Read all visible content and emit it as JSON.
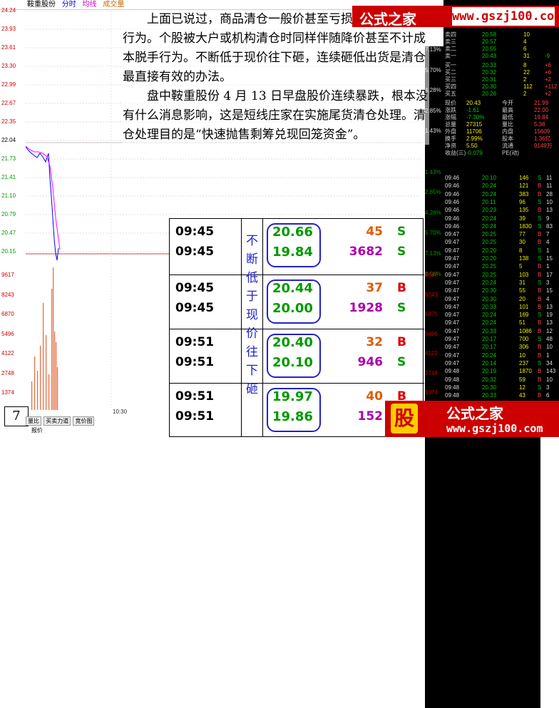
{
  "chart_header": {
    "stock_name": "鞍重股份",
    "tab_timeshare": "分时",
    "tab_avg": "均线",
    "tab_volume": "成交量"
  },
  "price_axis_left": [
    "24.24",
    "23.93",
    "23.61",
    "23.30",
    "22.99",
    "22.67",
    "22.35",
    "22.04",
    "21.73",
    "21.41",
    "21.10",
    "20.79",
    "20.47",
    "20.15"
  ],
  "price_axis_right": [
    "7.13%",
    "5.70%",
    "4.28%",
    "2.85%",
    "1.43%",
    "0.00%",
    "1.43%",
    "2.85%",
    "4.28%",
    "5.70%",
    "7.13%",
    "8.56%"
  ],
  "volume_axis_left": [
    "9617",
    "8243",
    "6870",
    "5496",
    "4122",
    "2748",
    "1374"
  ],
  "volume_axis_right": [
    "9617",
    "8243",
    "6870",
    "5496",
    "4122",
    "2748",
    "1374"
  ],
  "x_tick": "10:30",
  "bottom_tabs": [
    "量比",
    "买卖力道",
    "竞价图"
  ],
  "bottom_tab_extra": "报价",
  "page_number": "7",
  "body_text": {
    "p1": "上面已说过，商品清仓一般价甚至亏损不计成本抛售行为。个股被大户或机构清仓时同样伴随降价甚至不计成本脱手行为。不断低于现价往下砸，连续砸低出货是清仓最直接有效的办法。",
    "p2": "盘中鞍重股份 4 月 13 日早盘股价连续暴跌，根本没有什么消息影响，这是短线庄家在实施尾货清仓处理。清仓处理目的是“快速抛售剩筹兑现回笼资金”。"
  },
  "table": {
    "side_caption": [
      "不",
      "断",
      "低",
      "于",
      "现",
      "价",
      "往",
      "下",
      "砸"
    ],
    "groups": [
      {
        "rows": [
          {
            "time": "09:45",
            "price": "20.66",
            "vol": "45",
            "side": "S",
            "vol_color": "#e05a00",
            "side_color": "#090"
          },
          {
            "time": "09:45",
            "price": "19.84",
            "vol": "3682",
            "side": "S",
            "vol_color": "#a0a",
            "side_color": "#090"
          }
        ]
      },
      {
        "rows": [
          {
            "time": "09:45",
            "price": "20.44",
            "vol": "37",
            "side": "B",
            "vol_color": "#e05a00",
            "side_color": "#d00"
          },
          {
            "time": "09:45",
            "price": "20.00",
            "vol": "1928",
            "side": "S",
            "vol_color": "#a0a",
            "side_color": "#090"
          }
        ]
      },
      {
        "rows": [
          {
            "time": "09:51",
            "price": "20.40",
            "vol": "32",
            "side": "B",
            "vol_color": "#e05a00",
            "side_color": "#d00"
          },
          {
            "time": "09:51",
            "price": "20.10",
            "vol": "946",
            "side": "S",
            "vol_color": "#a0a",
            "side_color": "#090"
          }
        ]
      },
      {
        "rows": [
          {
            "time": "09:51",
            "price": "19.97",
            "vol": "40",
            "side": "B",
            "vol_color": "#e05a00",
            "side_color": "#d00"
          },
          {
            "time": "09:51",
            "price": "19.86",
            "vol": "152",
            "side": "S",
            "vol_color": "#a0a",
            "side_color": "#090"
          }
        ]
      }
    ]
  },
  "logo_top": {
    "cn": "公式之家",
    "url": "www.gszj100.com"
  },
  "logo_bottom": {
    "stamp": "股",
    "cn": "公式之家",
    "url": "www.gszj100.com"
  },
  "quote": {
    "asks": [
      {
        "label": "卖四",
        "price": "20.58",
        "vol": "10",
        "chg": ""
      },
      {
        "label": "卖三",
        "price": "20.57",
        "vol": "4",
        "chg": ""
      },
      {
        "label": "卖二",
        "price": "20.55",
        "vol": "6",
        "chg": ""
      },
      {
        "label": "卖一",
        "price": "20.43",
        "vol": "31",
        "chg": "-9"
      }
    ],
    "bids": [
      {
        "label": "买一",
        "price": "20.33",
        "vol": "8",
        "chg": "+6"
      },
      {
        "label": "买二",
        "price": "20.32",
        "vol": "22",
        "chg": "+6"
      },
      {
        "label": "买三",
        "price": "20.31",
        "vol": "2",
        "chg": "+2"
      },
      {
        "label": "买四",
        "price": "20.30",
        "vol": "112",
        "chg": "+112"
      },
      {
        "label": "买五",
        "price": "20.26",
        "vol": "2",
        "chg": "+2"
      }
    ],
    "stats": [
      {
        "l1": "现价",
        "v1": "20.43",
        "l2": "今开",
        "v2": "21.99"
      },
      {
        "l1": "涨跌",
        "v1": "-1.61",
        "l2": "最高",
        "v2": "22.00"
      },
      {
        "l1": "涨幅",
        "v1": "-7.30%",
        "l2": "最低",
        "v2": "19.84"
      },
      {
        "l1": "总量",
        "v1": "27315",
        "l2": "量比",
        "v2": "5.38"
      },
      {
        "l1": "外盘",
        "v1": "11706",
        "l2": "内盘",
        "v2": "15609"
      },
      {
        "l1": "换手",
        "v1": "2.99%",
        "l2": "股本",
        "v2": "1.36亿"
      },
      {
        "l1": "净资",
        "v1": "5.50",
        "l2": "流通",
        "v2": "9149万"
      },
      {
        "l1": "收益(三)",
        "v1": "-0.079",
        "l2": "PE(动)",
        "v2": ""
      }
    ]
  },
  "ticks": [
    {
      "t": "09:46",
      "p": "20.10",
      "v": "146",
      "s": "S",
      "n": "11"
    },
    {
      "t": "09:46",
      "p": "20.24",
      "v": "121",
      "s": "B",
      "n": "11"
    },
    {
      "t": "09:46",
      "p": "20.24",
      "v": "383",
      "s": "B",
      "n": "28"
    },
    {
      "t": "09:46",
      "p": "20.11",
      "v": "96",
      "s": "S",
      "n": "10"
    },
    {
      "t": "09:46",
      "p": "20.23",
      "v": "135",
      "s": "B",
      "n": "13"
    },
    {
      "t": "09:46",
      "p": "20.24",
      "v": "39",
      "s": "S",
      "n": "9"
    },
    {
      "t": "09:46",
      "p": "20.24",
      "v": "1830",
      "s": "S",
      "n": "83"
    },
    {
      "t": "09:47",
      "p": "20.25",
      "v": "77",
      "s": "B",
      "n": "7"
    },
    {
      "t": "09:47",
      "p": "20.25",
      "v": "30",
      "s": "B",
      "n": "4"
    },
    {
      "t": "09:47",
      "p": "20.20",
      "v": "8",
      "s": "S",
      "n": "1"
    },
    {
      "t": "09:47",
      "p": "20.20",
      "v": "138",
      "s": "S",
      "n": "15"
    },
    {
      "t": "09:47",
      "p": "20.25",
      "v": "5",
      "s": "B",
      "n": "1"
    },
    {
      "t": "09:47",
      "p": "20.25",
      "v": "103",
      "s": "B",
      "n": "17"
    },
    {
      "t": "09:47",
      "p": "20.24",
      "v": "31",
      "s": "S",
      "n": "3"
    },
    {
      "t": "09:47",
      "p": "20.30",
      "v": "55",
      "s": "B",
      "n": "15"
    },
    {
      "t": "09:47",
      "p": "20.30",
      "v": "20",
      "s": "B",
      "n": "4"
    },
    {
      "t": "09:47",
      "p": "20.33",
      "v": "101",
      "s": "B",
      "n": "13"
    },
    {
      "t": "09:47",
      "p": "20.24",
      "v": "169",
      "s": "S",
      "n": "19"
    },
    {
      "t": "09:47",
      "p": "20.24",
      "v": "51",
      "s": "B",
      "n": "13"
    },
    {
      "t": "09:47",
      "p": "20.33",
      "v": "1086",
      "s": "B",
      "n": "12"
    },
    {
      "t": "09:47",
      "p": "20.17",
      "v": "700",
      "s": "S",
      "n": "48"
    },
    {
      "t": "09:47",
      "p": "20.17",
      "v": "306",
      "s": "B",
      "n": "10"
    },
    {
      "t": "09:47",
      "p": "20.24",
      "v": "10",
      "s": "B",
      "n": "1"
    },
    {
      "t": "09:47",
      "p": "20.14",
      "v": "237",
      "s": "S",
      "n": "34"
    },
    {
      "t": "09:48",
      "p": "20.19",
      "v": "1870",
      "s": "B",
      "n": "143"
    },
    {
      "t": "09:48",
      "p": "20.32",
      "v": "59",
      "s": "B",
      "n": "10"
    },
    {
      "t": "09:48",
      "p": "20.30",
      "v": "12",
      "s": "S",
      "n": "3"
    },
    {
      "t": "09:48",
      "p": "20.33",
      "v": "43",
      "s": "B",
      "n": "6"
    }
  ]
}
